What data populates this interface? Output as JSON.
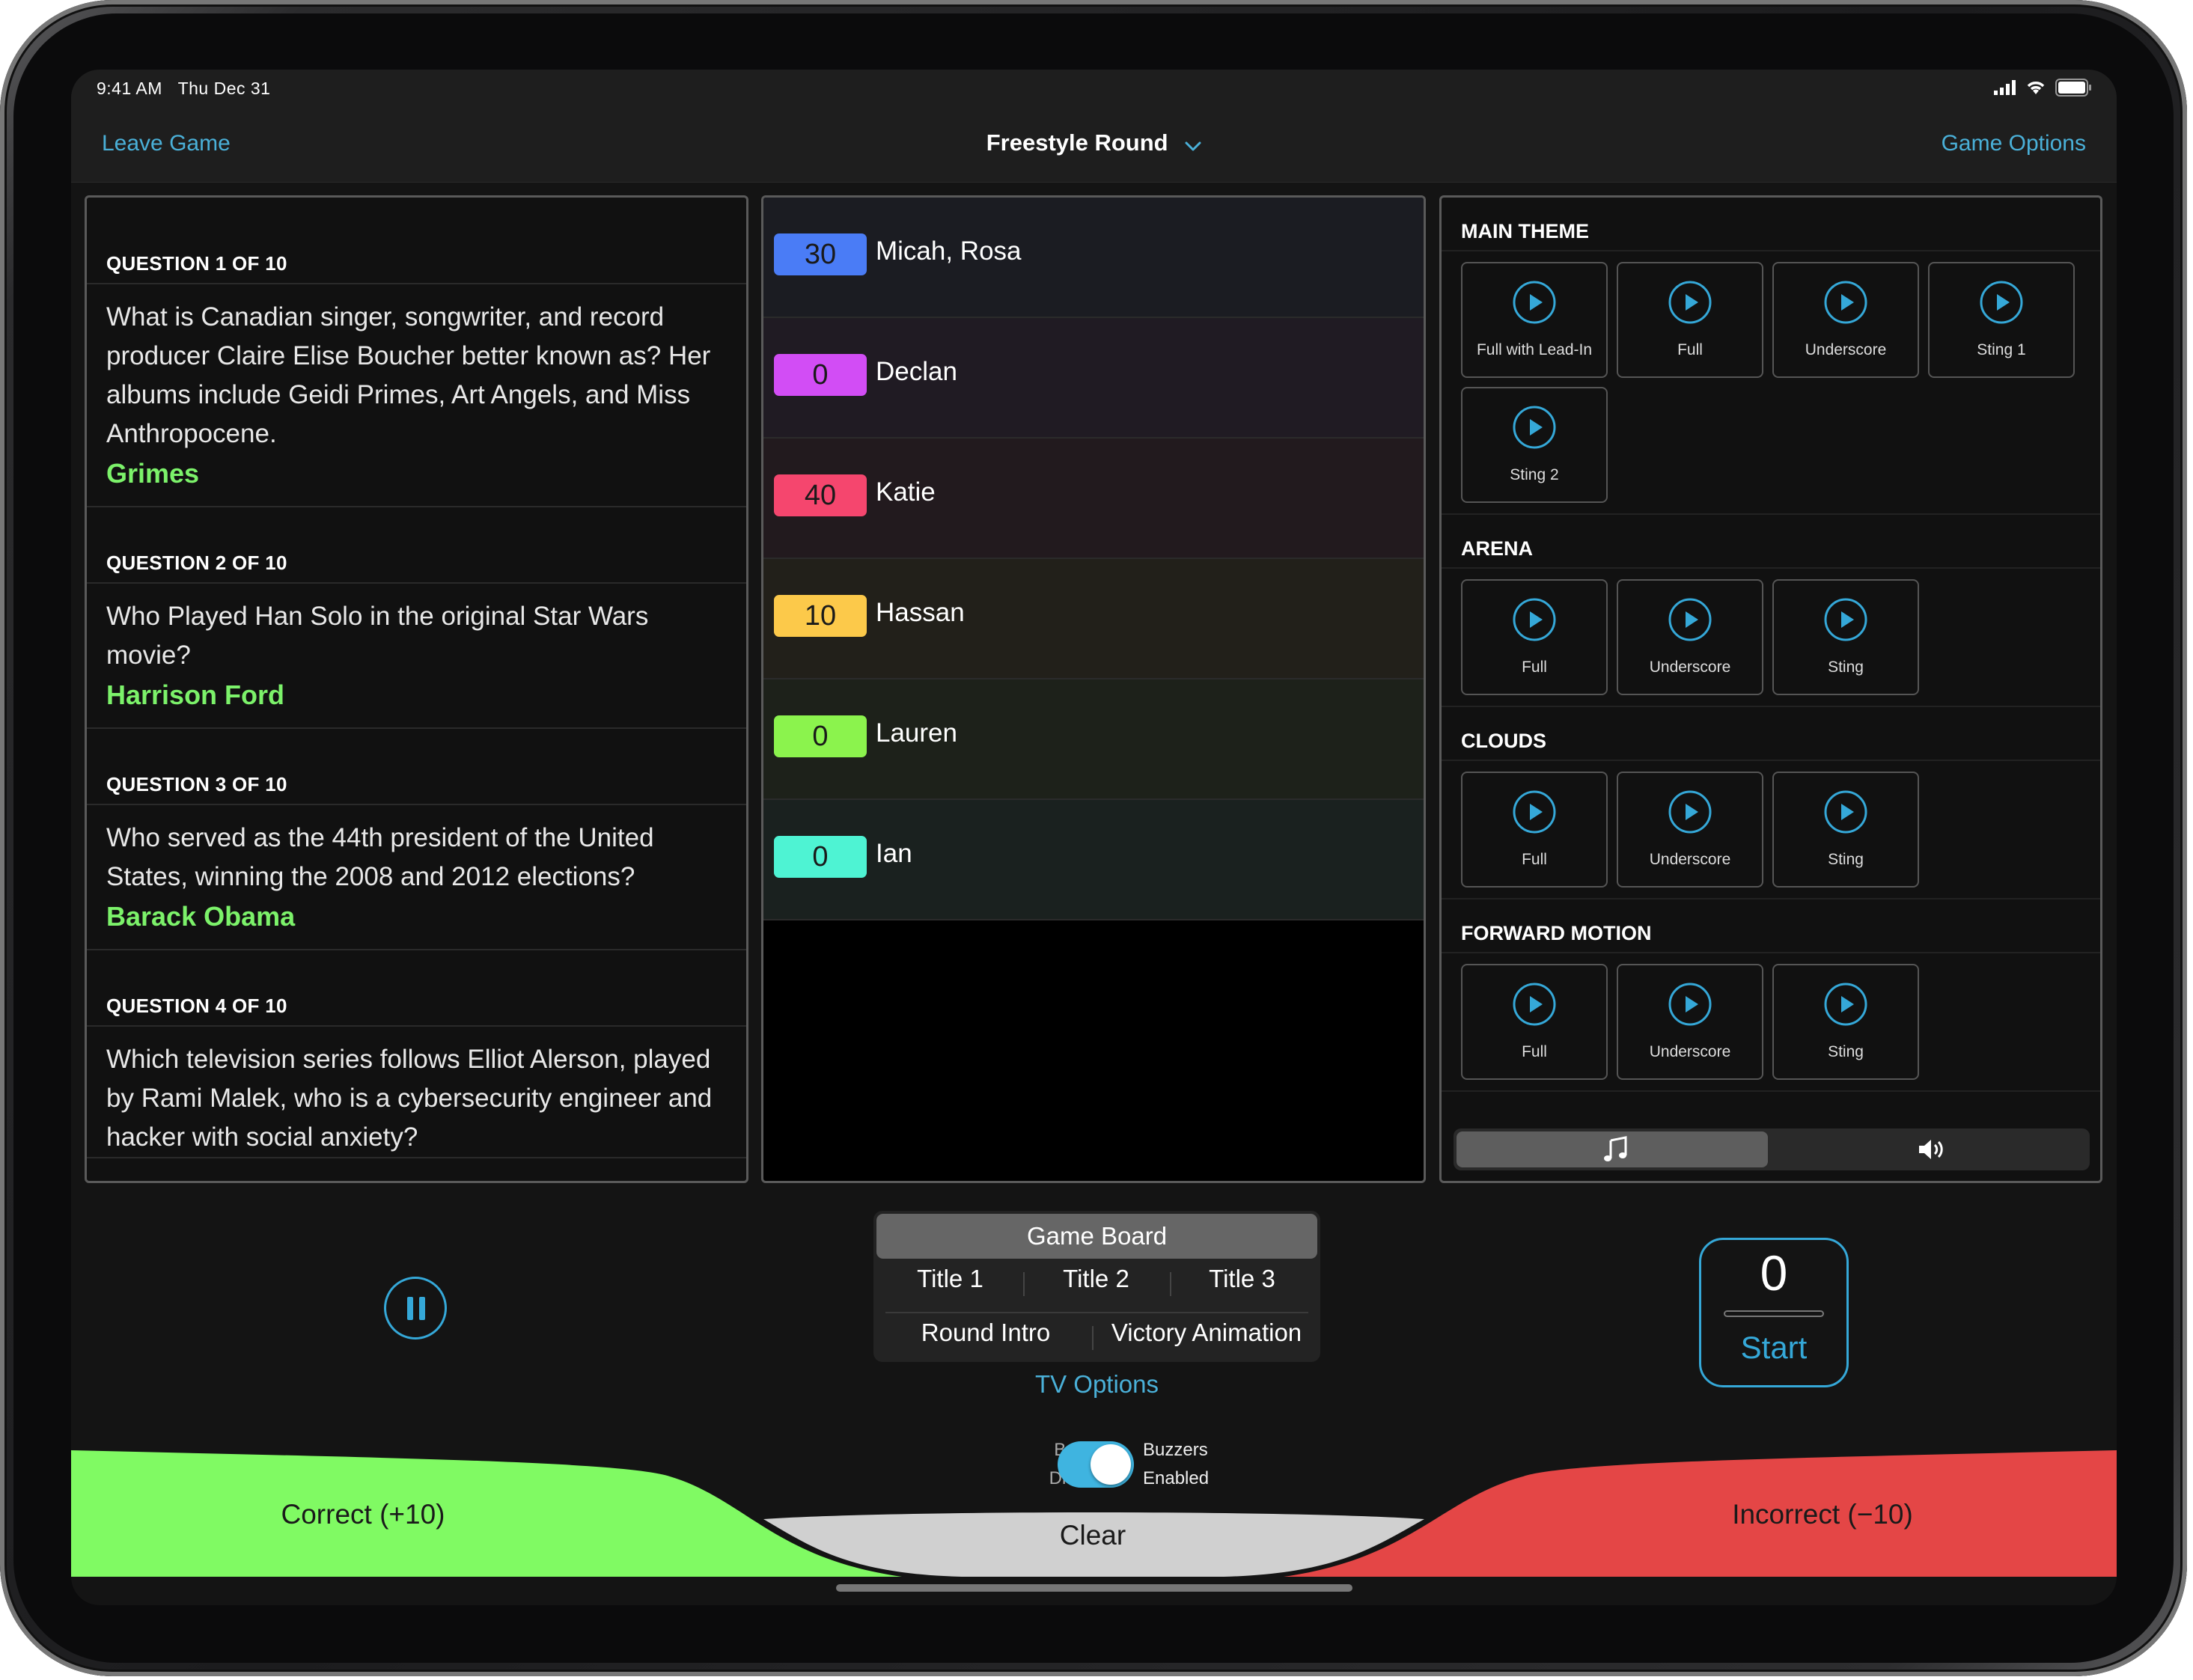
{
  "status_bar": {
    "time": "9:41 AM",
    "date": "Thu Dec 31"
  },
  "nav": {
    "left": "Leave Game",
    "title": "Freestyle Round",
    "right": "Game Options"
  },
  "questions": [
    {
      "header": "QUESTION 1 OF 10",
      "text": "What is Canadian singer, songwriter, and record producer Claire Elise Boucher better known as? Her albums include Geidi Primes, Art Angels, and Miss Anthropocene.",
      "answer": "Grimes"
    },
    {
      "header": "QUESTION 2 OF 10",
      "text": "Who Played Han Solo in the original Star Wars movie?",
      "answer": "Harrison Ford"
    },
    {
      "header": "QUESTION 3 OF 10",
      "text": "Who served as the 44th president of the United States, winning the 2008 and 2012 elections?",
      "answer": "Barack Obama"
    },
    {
      "header": "QUESTION 4 OF 10",
      "text": "Which television series follows Elliot Alerson, played by Rami Malek, who is a cybersecurity engineer and hacker with social anxiety?",
      "answer": ""
    }
  ],
  "scores": [
    {
      "score": "30",
      "name": "Micah, Rosa",
      "badge_color": "#4a7cf6",
      "row_color": "#1b1c22"
    },
    {
      "score": "0",
      "name": "Declan",
      "badge_color": "#d24df5",
      "row_color": "#201b23"
    },
    {
      "score": "40",
      "name": "Katie",
      "badge_color": "#f5466e",
      "row_color": "#221a1e"
    },
    {
      "score": "10",
      "name": "Hassan",
      "badge_color": "#fcc94a",
      "row_color": "#22201a"
    },
    {
      "score": "0",
      "name": "Lauren",
      "badge_color": "#8bf34d",
      "row_color": "#1d211a"
    },
    {
      "score": "0",
      "name": "Ian",
      "badge_color": "#4ef3d3",
      "row_color": "#1a211f"
    }
  ],
  "media": {
    "sections": [
      {
        "title": "MAIN THEME",
        "buttons": [
          "Full with Lead-In",
          "Full",
          "Underscore",
          "Sting 1",
          "Sting 2"
        ]
      },
      {
        "title": "ARENA",
        "buttons": [
          "Full",
          "Underscore",
          "Sting"
        ]
      },
      {
        "title": "CLOUDS",
        "buttons": [
          "Full",
          "Underscore",
          "Sting"
        ]
      },
      {
        "title": "FORWARD MOTION",
        "buttons": [
          "Full",
          "Underscore",
          "Sting"
        ]
      }
    ],
    "tabs": [
      "music-note-icon",
      "speaker-icon"
    ]
  },
  "tv_panel": {
    "header": "Game Board",
    "row1": [
      "Title 1",
      "Title 2",
      "Title 3"
    ],
    "row2": [
      "Round Intro",
      "Victory Animation"
    ],
    "options_link": "TV Options"
  },
  "start": {
    "count": "0",
    "label": "Start"
  },
  "buzzers": {
    "left_line1": "Buzzers",
    "left_line2": "Disabled",
    "right_line1": "Buzzers",
    "right_line2": "Enabled",
    "enabled": true
  },
  "actions": {
    "correct": "Correct (+10)",
    "clear": "Clear",
    "incorrect": "Incorrect (−10)"
  },
  "colors": {
    "accent": "#4ab0d8",
    "answer_green": "#7cf26a",
    "correct_bg": "#80fa63",
    "incorrect_bg": "#e44646",
    "clear_bg": "#d0d0d0"
  }
}
